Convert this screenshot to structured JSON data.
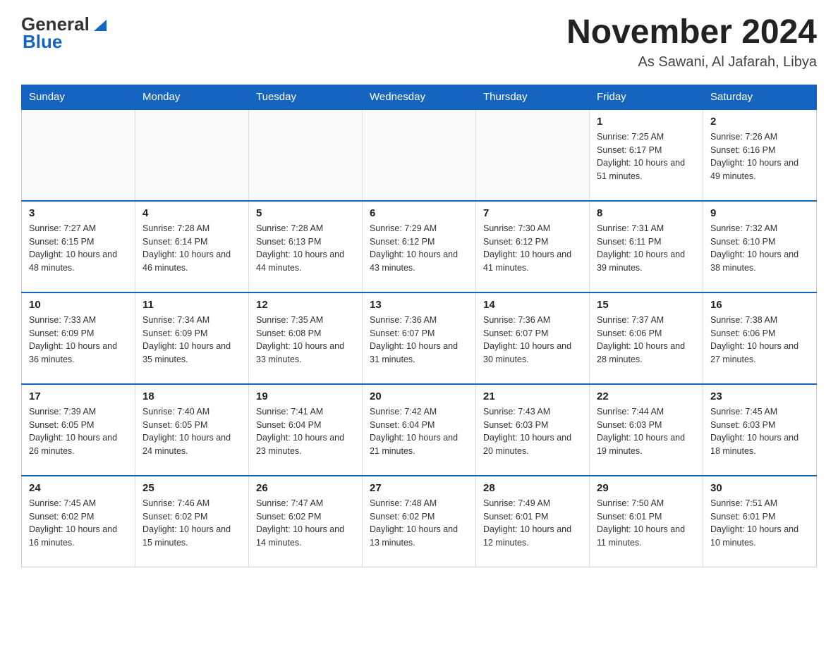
{
  "logo": {
    "text_general": "General",
    "text_blue": "Blue",
    "icon_symbol": "▶"
  },
  "title": "November 2024",
  "subtitle": "As Sawani, Al Jafarah, Libya",
  "days_of_week": [
    "Sunday",
    "Monday",
    "Tuesday",
    "Wednesday",
    "Thursday",
    "Friday",
    "Saturday"
  ],
  "weeks": [
    [
      {
        "day": "",
        "info": ""
      },
      {
        "day": "",
        "info": ""
      },
      {
        "day": "",
        "info": ""
      },
      {
        "day": "",
        "info": ""
      },
      {
        "day": "",
        "info": ""
      },
      {
        "day": "1",
        "info": "Sunrise: 7:25 AM\nSunset: 6:17 PM\nDaylight: 10 hours and 51 minutes."
      },
      {
        "day": "2",
        "info": "Sunrise: 7:26 AM\nSunset: 6:16 PM\nDaylight: 10 hours and 49 minutes."
      }
    ],
    [
      {
        "day": "3",
        "info": "Sunrise: 7:27 AM\nSunset: 6:15 PM\nDaylight: 10 hours and 48 minutes."
      },
      {
        "day": "4",
        "info": "Sunrise: 7:28 AM\nSunset: 6:14 PM\nDaylight: 10 hours and 46 minutes."
      },
      {
        "day": "5",
        "info": "Sunrise: 7:28 AM\nSunset: 6:13 PM\nDaylight: 10 hours and 44 minutes."
      },
      {
        "day": "6",
        "info": "Sunrise: 7:29 AM\nSunset: 6:12 PM\nDaylight: 10 hours and 43 minutes."
      },
      {
        "day": "7",
        "info": "Sunrise: 7:30 AM\nSunset: 6:12 PM\nDaylight: 10 hours and 41 minutes."
      },
      {
        "day": "8",
        "info": "Sunrise: 7:31 AM\nSunset: 6:11 PM\nDaylight: 10 hours and 39 minutes."
      },
      {
        "day": "9",
        "info": "Sunrise: 7:32 AM\nSunset: 6:10 PM\nDaylight: 10 hours and 38 minutes."
      }
    ],
    [
      {
        "day": "10",
        "info": "Sunrise: 7:33 AM\nSunset: 6:09 PM\nDaylight: 10 hours and 36 minutes."
      },
      {
        "day": "11",
        "info": "Sunrise: 7:34 AM\nSunset: 6:09 PM\nDaylight: 10 hours and 35 minutes."
      },
      {
        "day": "12",
        "info": "Sunrise: 7:35 AM\nSunset: 6:08 PM\nDaylight: 10 hours and 33 minutes."
      },
      {
        "day": "13",
        "info": "Sunrise: 7:36 AM\nSunset: 6:07 PM\nDaylight: 10 hours and 31 minutes."
      },
      {
        "day": "14",
        "info": "Sunrise: 7:36 AM\nSunset: 6:07 PM\nDaylight: 10 hours and 30 minutes."
      },
      {
        "day": "15",
        "info": "Sunrise: 7:37 AM\nSunset: 6:06 PM\nDaylight: 10 hours and 28 minutes."
      },
      {
        "day": "16",
        "info": "Sunrise: 7:38 AM\nSunset: 6:06 PM\nDaylight: 10 hours and 27 minutes."
      }
    ],
    [
      {
        "day": "17",
        "info": "Sunrise: 7:39 AM\nSunset: 6:05 PM\nDaylight: 10 hours and 26 minutes."
      },
      {
        "day": "18",
        "info": "Sunrise: 7:40 AM\nSunset: 6:05 PM\nDaylight: 10 hours and 24 minutes."
      },
      {
        "day": "19",
        "info": "Sunrise: 7:41 AM\nSunset: 6:04 PM\nDaylight: 10 hours and 23 minutes."
      },
      {
        "day": "20",
        "info": "Sunrise: 7:42 AM\nSunset: 6:04 PM\nDaylight: 10 hours and 21 minutes."
      },
      {
        "day": "21",
        "info": "Sunrise: 7:43 AM\nSunset: 6:03 PM\nDaylight: 10 hours and 20 minutes."
      },
      {
        "day": "22",
        "info": "Sunrise: 7:44 AM\nSunset: 6:03 PM\nDaylight: 10 hours and 19 minutes."
      },
      {
        "day": "23",
        "info": "Sunrise: 7:45 AM\nSunset: 6:03 PM\nDaylight: 10 hours and 18 minutes."
      }
    ],
    [
      {
        "day": "24",
        "info": "Sunrise: 7:45 AM\nSunset: 6:02 PM\nDaylight: 10 hours and 16 minutes."
      },
      {
        "day": "25",
        "info": "Sunrise: 7:46 AM\nSunset: 6:02 PM\nDaylight: 10 hours and 15 minutes."
      },
      {
        "day": "26",
        "info": "Sunrise: 7:47 AM\nSunset: 6:02 PM\nDaylight: 10 hours and 14 minutes."
      },
      {
        "day": "27",
        "info": "Sunrise: 7:48 AM\nSunset: 6:02 PM\nDaylight: 10 hours and 13 minutes."
      },
      {
        "day": "28",
        "info": "Sunrise: 7:49 AM\nSunset: 6:01 PM\nDaylight: 10 hours and 12 minutes."
      },
      {
        "day": "29",
        "info": "Sunrise: 7:50 AM\nSunset: 6:01 PM\nDaylight: 10 hours and 11 minutes."
      },
      {
        "day": "30",
        "info": "Sunrise: 7:51 AM\nSunset: 6:01 PM\nDaylight: 10 hours and 10 minutes."
      }
    ]
  ]
}
